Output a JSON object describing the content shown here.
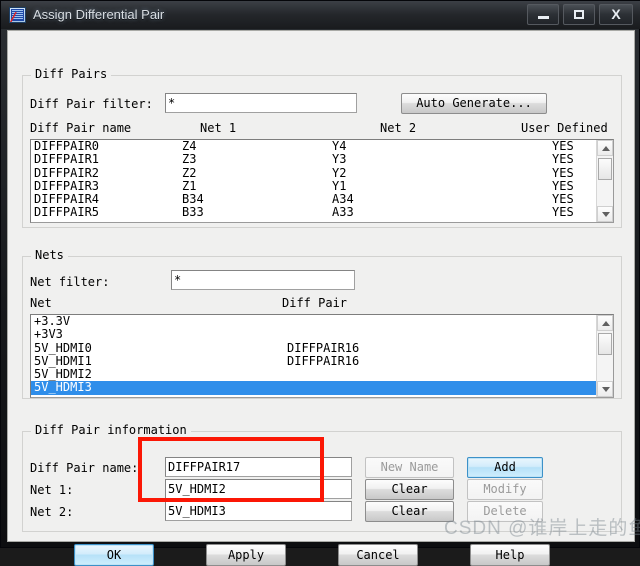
{
  "window": {
    "title": "Assign Differential Pair",
    "icon": "app-icon",
    "controls": {
      "minimize": "minimize-icon",
      "maximize": "restore-icon",
      "close": "X"
    }
  },
  "diff_pairs_group": {
    "legend": "Diff Pairs",
    "filter_label": "Diff Pair filter:",
    "filter_value": "*",
    "auto_generate_label": "Auto Generate...",
    "columns": [
      "Diff Pair name",
      "Net 1",
      "Net 2",
      "User Defined"
    ],
    "rows": [
      {
        "name": "DIFFPAIR0",
        "net1": "Z4",
        "net2": "Y4",
        "user_defined": "YES"
      },
      {
        "name": "DIFFPAIR1",
        "net1": "Z3",
        "net2": "Y3",
        "user_defined": "YES"
      },
      {
        "name": "DIFFPAIR2",
        "net1": "Z2",
        "net2": "Y2",
        "user_defined": "YES"
      },
      {
        "name": "DIFFPAIR3",
        "net1": "Z1",
        "net2": "Y1",
        "user_defined": "YES"
      },
      {
        "name": "DIFFPAIR4",
        "net1": "B34",
        "net2": "A34",
        "user_defined": "YES"
      },
      {
        "name": "DIFFPAIR5",
        "net1": "B33",
        "net2": "A33",
        "user_defined": "YES"
      }
    ]
  },
  "nets_group": {
    "legend": "Nets",
    "filter_label": "Net filter:",
    "filter_value": "*",
    "columns": [
      "Net",
      "Diff Pair"
    ],
    "rows": [
      {
        "net": "+3.3V",
        "diff_pair": "",
        "selected": false
      },
      {
        "net": "+3V3",
        "diff_pair": "",
        "selected": false
      },
      {
        "net": "5V_HDMI0",
        "diff_pair": "DIFFPAIR16",
        "selected": false
      },
      {
        "net": "5V_HDMI1",
        "diff_pair": "DIFFPAIR16",
        "selected": false
      },
      {
        "net": "5V_HDMI2",
        "diff_pair": "",
        "selected": false
      },
      {
        "net": "5V_HDMI3",
        "diff_pair": "",
        "selected": true
      }
    ],
    "selection_color": "#2f8eea"
  },
  "info_group": {
    "legend": "Diff Pair information",
    "name_label": "Diff Pair name:",
    "name_value": "DIFFPAIR17",
    "net1_label": "Net 1:",
    "net1_value": "5V_HDMI2",
    "net2_label": "Net 2:",
    "net2_value": "5V_HDMI3",
    "new_name_label": "New Name",
    "clear1_label": "Clear",
    "clear2_label": "Clear",
    "add_label": "Add",
    "modify_label": "Modify",
    "delete_label": "Delete"
  },
  "footer": {
    "ok_label": "OK",
    "apply_label": "Apply",
    "cancel_label": "Cancel",
    "help_label": "Help"
  },
  "annotation": {
    "color": "#fb1705",
    "watermark": "CSDN @谁岸上走的鱼"
  }
}
